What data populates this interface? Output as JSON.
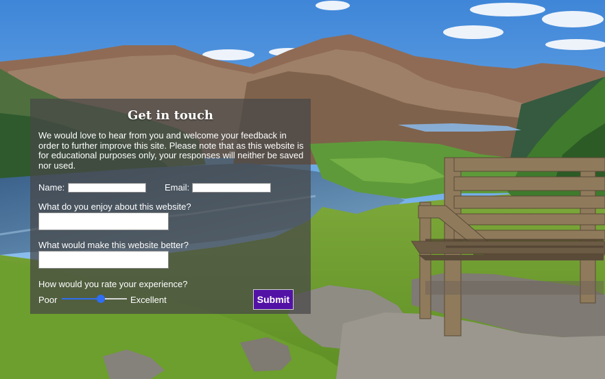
{
  "form": {
    "title": "Get in touch",
    "intro": "We would love to hear from you and welcome your feedback in order to further improve this site. Please note that as this website is for educational purposes only, your responses will neither be saved nor used.",
    "name_label": "Name:",
    "name_value": "",
    "email_label": "Email:",
    "email_value": "",
    "enjoy_label": "What do you enjoy about this website?",
    "enjoy_value": "",
    "better_label": "What would make this website better?",
    "better_value": "",
    "rating_label": "How would you rate your experience?",
    "rating_min_label": "Poor",
    "rating_max_label": "Excellent",
    "rating_value_fraction": 0.6,
    "submit_label": "Submit"
  },
  "colors": {
    "panel": "#464646",
    "submit": "#5312a6",
    "slider": "#2f6ef2"
  }
}
